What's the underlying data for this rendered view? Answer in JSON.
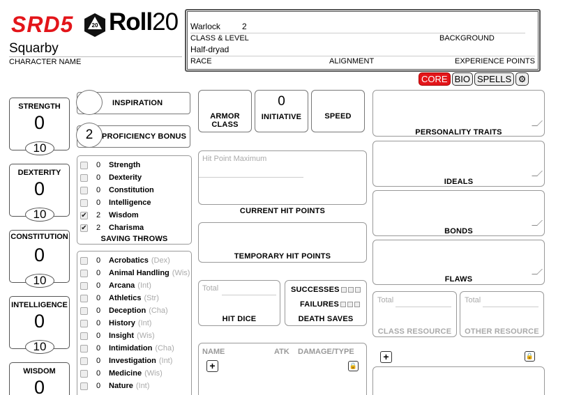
{
  "logo": {
    "srd": "SRD5",
    "roll": "Roll",
    "roll_num": "20",
    "die_num": "20"
  },
  "character": {
    "name": "Squarby",
    "name_label": "CHARACTER NAME"
  },
  "header": {
    "class_level_value": "Warlock",
    "level_value": "2",
    "class_level_label": "CLASS & LEVEL",
    "background_label": "BACKGROUND",
    "race_value": "Half-dryad",
    "race_label": "RACE",
    "alignment_label": "ALIGNMENT",
    "xp_label": "EXPERIENCE POINTS"
  },
  "tabs": [
    {
      "label": "CORE"
    },
    {
      "label": "BIO"
    },
    {
      "label": "SPELLS"
    }
  ],
  "abilities": [
    {
      "name": "STRENGTH",
      "modifier": "0",
      "score": "10"
    },
    {
      "name": "DEXTERITY",
      "modifier": "0",
      "score": "10"
    },
    {
      "name": "CONSTITUTION",
      "modifier": "0",
      "score": "10"
    },
    {
      "name": "INTELLIGENCE",
      "modifier": "0",
      "score": "10"
    },
    {
      "name": "WISDOM",
      "modifier": "0",
      "score": ""
    }
  ],
  "inspiration": {
    "label": "INSPIRATION",
    "value": ""
  },
  "proficiency": {
    "label": "PROFICIENCY BONUS",
    "value": "2"
  },
  "saving_throws": {
    "label": "SAVING THROWS",
    "items": [
      {
        "name": "Strength",
        "value": "0",
        "checked": false
      },
      {
        "name": "Dexterity",
        "value": "0",
        "checked": false
      },
      {
        "name": "Constitution",
        "value": "0",
        "checked": false
      },
      {
        "name": "Intelligence",
        "value": "0",
        "checked": false
      },
      {
        "name": "Wisdom",
        "value": "2",
        "checked": true
      },
      {
        "name": "Charisma",
        "value": "2",
        "checked": true
      }
    ]
  },
  "skills": [
    {
      "name": "Acrobatics",
      "ability": "(Dex)",
      "value": "0"
    },
    {
      "name": "Animal Handling",
      "ability": "(Wis)",
      "value": "0"
    },
    {
      "name": "Arcana",
      "ability": "(Int)",
      "value": "0"
    },
    {
      "name": "Athletics",
      "ability": "(Str)",
      "value": "0"
    },
    {
      "name": "Deception",
      "ability": "(Cha)",
      "value": "0"
    },
    {
      "name": "History",
      "ability": "(Int)",
      "value": "0"
    },
    {
      "name": "Insight",
      "ability": "(Wis)",
      "value": "0"
    },
    {
      "name": "Intimidation",
      "ability": "(Cha)",
      "value": "0"
    },
    {
      "name": "Investigation",
      "ability": "(Int)",
      "value": "0"
    },
    {
      "name": "Medicine",
      "ability": "(Wis)",
      "value": "0"
    },
    {
      "name": "Nature",
      "ability": "(Int)",
      "value": "0"
    }
  ],
  "combat": {
    "armor_class_label": "ARMOR CLASS",
    "initiative_label": "INITIATIVE",
    "initiative_value": "0",
    "speed_label": "SPEED"
  },
  "hp": {
    "max_placeholder": "Hit Point Maximum",
    "current_label": "CURRENT HIT POINTS",
    "temp_label": "TEMPORARY HIT POINTS"
  },
  "hit_dice": {
    "total_placeholder": "Total",
    "label": "HIT DICE"
  },
  "death_saves": {
    "successes_label": "SUCCESSES",
    "failures_label": "FAILURES",
    "label": "DEATH SAVES"
  },
  "attacks": {
    "name_col": "NAME",
    "atk_col": "ATK",
    "damage_col": "DAMAGE/TYPE",
    "add_symbol": "+",
    "lock_symbol": "🔒"
  },
  "traits": {
    "personality_label": "PERSONALITY TRAITS",
    "ideals_label": "IDEALS",
    "bonds_label": "BONDS",
    "flaws_label": "FLAWS"
  },
  "resources": {
    "class_total": "Total",
    "class_label": "CLASS RESOURCE",
    "other_total": "Total",
    "other_label": "OTHER RESOURCE"
  },
  "features": {
    "add_symbol": "+",
    "lock_symbol": "🔒"
  },
  "colors": {
    "brand_red": "#e3151a"
  }
}
